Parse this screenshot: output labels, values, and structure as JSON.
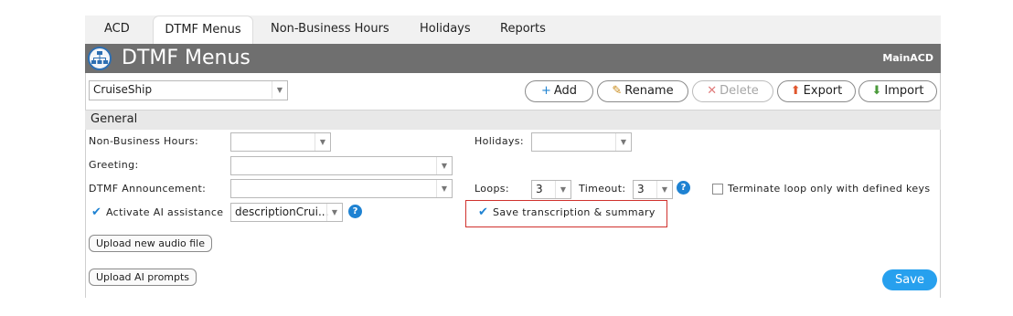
{
  "tabs": [
    {
      "label": "ACD",
      "active": false
    },
    {
      "label": "DTMF Menus",
      "active": true
    },
    {
      "label": "Non-Business Hours",
      "active": false
    },
    {
      "label": "Holidays",
      "active": false
    },
    {
      "label": "Reports",
      "active": false
    }
  ],
  "header": {
    "title": "DTMF Menus",
    "right_label": "MainACD",
    "icon": "org-chart-icon"
  },
  "menu_select": {
    "value": "CruiseShip"
  },
  "toolbar": {
    "add": "Add",
    "rename": "Rename",
    "delete": "Delete",
    "export": "Export",
    "import": "Import"
  },
  "section": {
    "title": "General"
  },
  "fields": {
    "non_business_hours": {
      "label": "Non-Business Hours:",
      "value": ""
    },
    "holidays": {
      "label": "Holidays:",
      "value": ""
    },
    "greeting": {
      "label": "Greeting:",
      "value": ""
    },
    "dtmf_announcement": {
      "label": "DTMF Announcement:",
      "value": ""
    },
    "loops": {
      "label": "Loops:",
      "value": "3"
    },
    "timeout": {
      "label": "Timeout:",
      "value": "3"
    },
    "terminate_loop": {
      "label": "Terminate loop only with defined keys",
      "checked": false
    },
    "ai_assistance": {
      "label": "Activate AI assistance",
      "checked": true,
      "value": "descriptionCrui..."
    },
    "save_transcription": {
      "label": "Save transcription & summary",
      "checked": true
    }
  },
  "buttons": {
    "upload_audio": "Upload new audio file",
    "upload_prompts": "Upload AI prompts",
    "save": "Save"
  },
  "colors": {
    "accent": "#27a0ee",
    "header_bg": "#6f6f6f",
    "highlight_border": "#d0312d"
  }
}
